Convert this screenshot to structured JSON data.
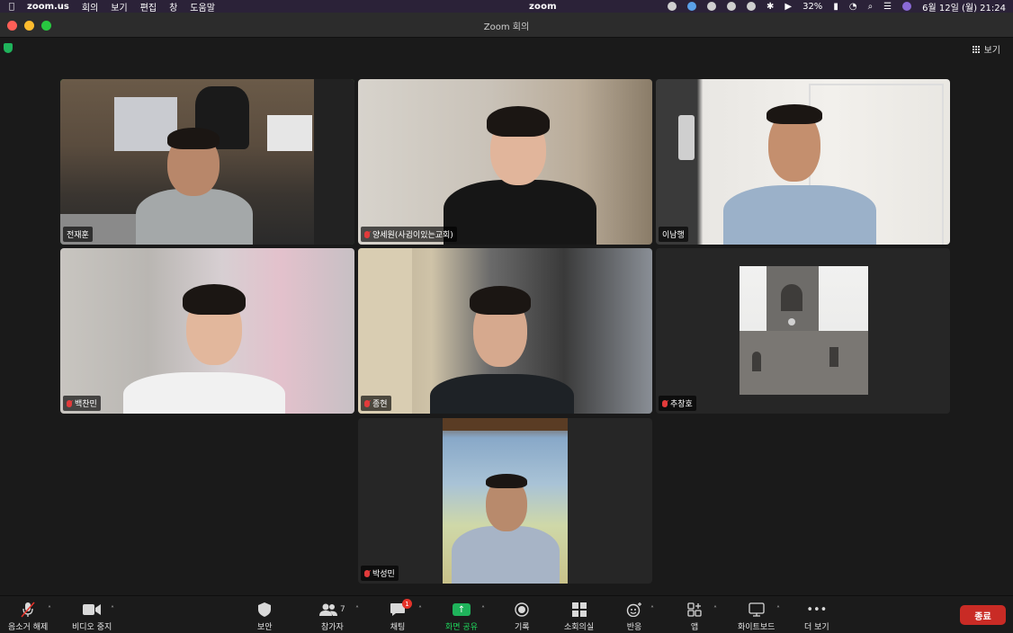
{
  "menubar": {
    "app_name": "zoom.us",
    "menus": [
      "회의",
      "보기",
      "편집",
      "창",
      "도움말"
    ],
    "center_label": "zoom",
    "battery": "32%",
    "datetime": "6월 12일 (월)  21:24"
  },
  "window": {
    "title": "Zoom 회의"
  },
  "view_button": {
    "label": "보기"
  },
  "participants": [
    {
      "name": "전재훈",
      "muted": false,
      "active_speaker": true
    },
    {
      "name": "양세원(사귐이있는교회)",
      "muted": true,
      "active_speaker": false
    },
    {
      "name": "이남행",
      "muted": false,
      "active_speaker": false
    },
    {
      "name": "백찬민",
      "muted": true,
      "active_speaker": false
    },
    {
      "name": "종현",
      "muted": true,
      "active_speaker": false
    },
    {
      "name": "추창호",
      "muted": true,
      "active_speaker": false
    },
    {
      "name": "박성민",
      "muted": true,
      "active_speaker": false
    }
  ],
  "toolbar": {
    "unmute": "음소거 해제",
    "stop_video": "비디오 중지",
    "security": "보안",
    "participants": "참가자",
    "participants_count": "7",
    "chat": "채팅",
    "chat_badge": "1",
    "share_screen": "화면 공유",
    "record": "기록",
    "breakout": "소회의실",
    "reactions": "반응",
    "apps": "앱",
    "whiteboard": "화이트보드",
    "more": "더 보기",
    "end": "종료"
  },
  "colors": {
    "active_border": "#2fd14a",
    "share_green": "#1fb35b",
    "end_red": "#c92b25",
    "mute_red": "#e23b3b"
  }
}
